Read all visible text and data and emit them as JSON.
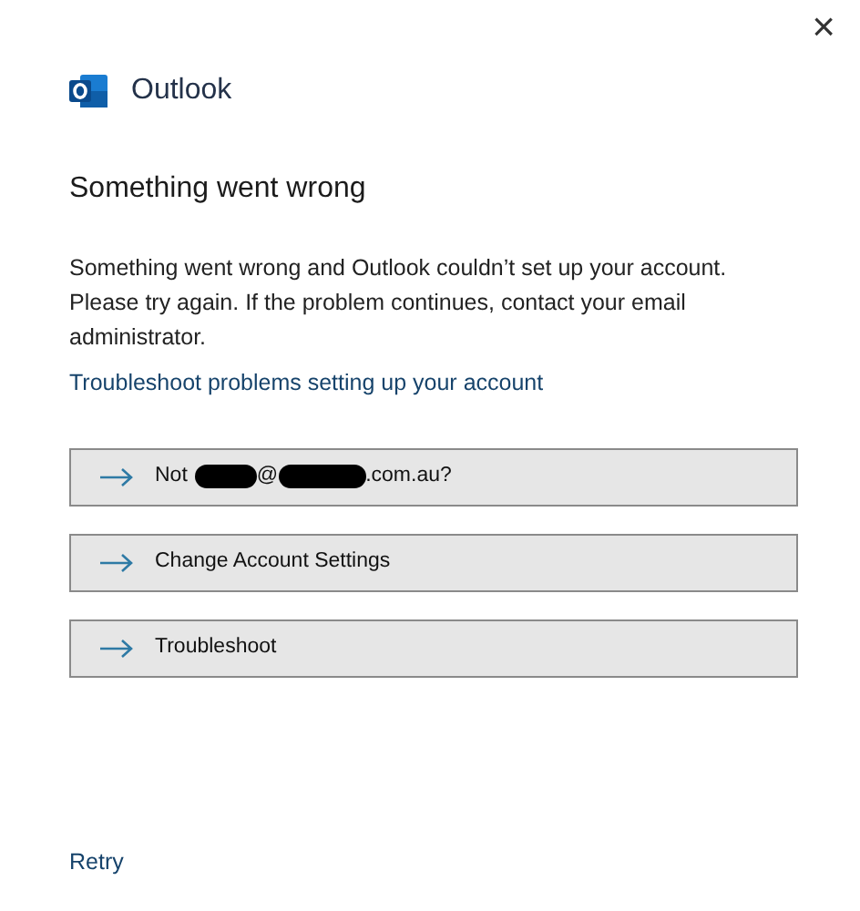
{
  "window": {
    "close": "×"
  },
  "app": {
    "name": "Outlook"
  },
  "heading": "Something went wrong",
  "message": "Something went wrong and Outlook couldn’t set up your account. Please try again. If the problem continues, contact your email administrator.",
  "link": "Troubleshoot problems setting up your account",
  "options": [
    {
      "parts": [
        {
          "kind": "text",
          "text": "Not"
        },
        {
          "kind": "redaction"
        },
        {
          "kind": "text",
          "text": "@"
        },
        {
          "kind": "redaction"
        },
        {
          "kind": "text",
          "text": ".com.au?"
        }
      ]
    },
    {
      "parts": [
        {
          "kind": "text",
          "text": "Change Account Settings"
        }
      ]
    },
    {
      "parts": [
        {
          "kind": "text",
          "text": "Troubleshoot"
        }
      ]
    }
  ],
  "retry": "Retry"
}
